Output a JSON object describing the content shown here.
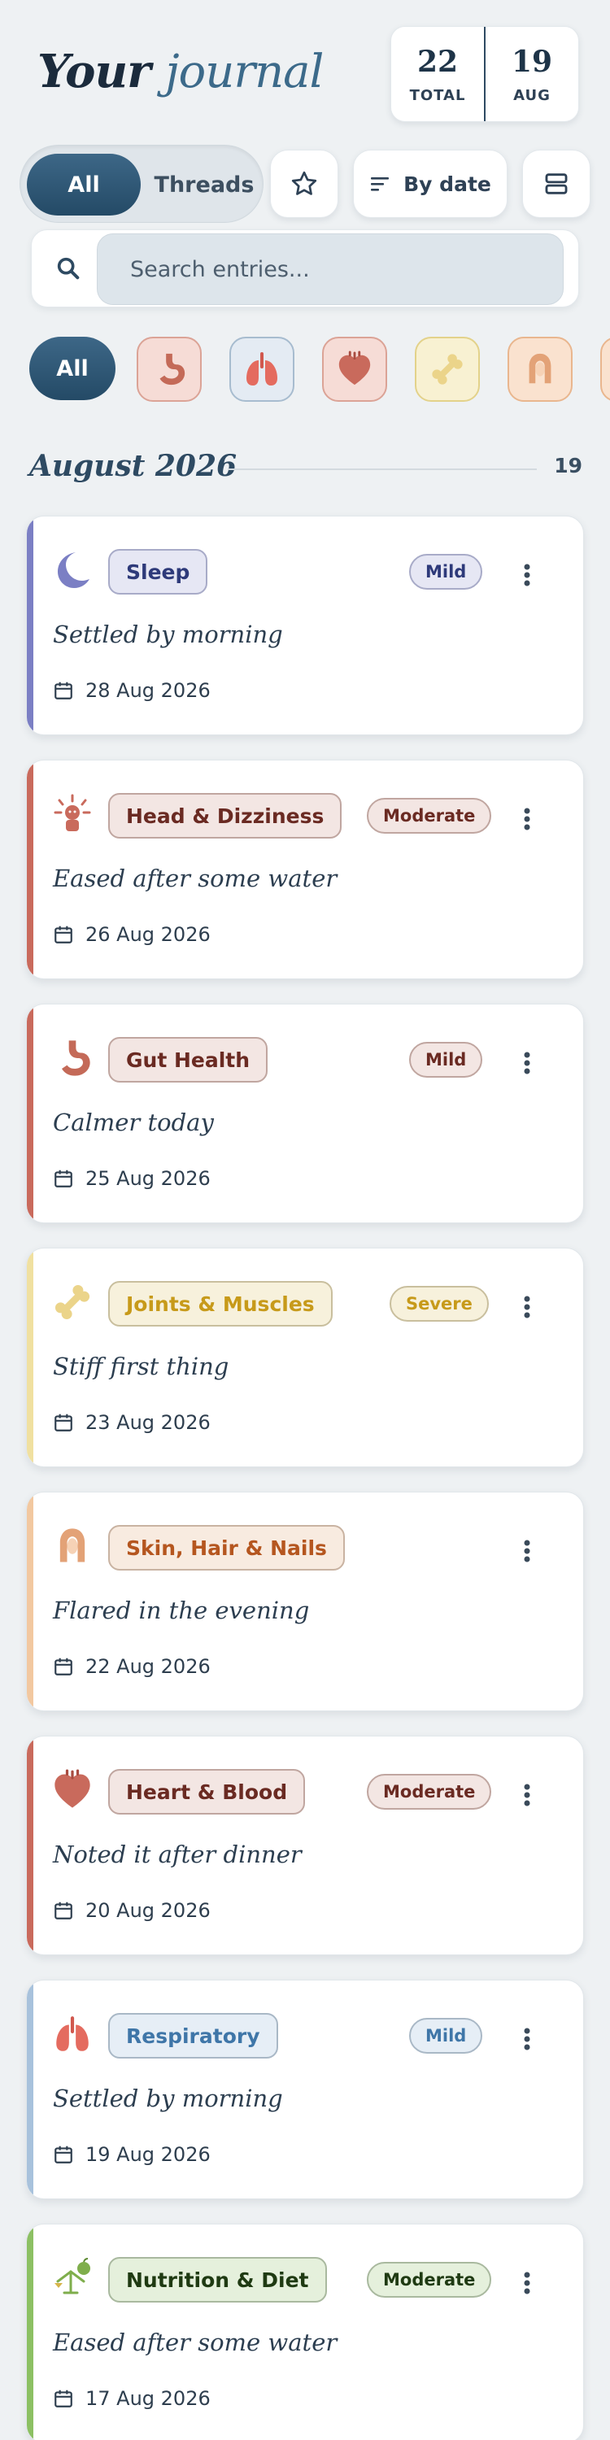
{
  "header": {
    "title_part1": "Your",
    "title_part2": "journal",
    "stats": [
      {
        "value": "22",
        "label": "TOTAL"
      },
      {
        "value": "19",
        "label": "AUG"
      }
    ]
  },
  "toolbar": {
    "segment_all": "All",
    "segment_threads": "Threads",
    "sort_label": "By date",
    "icons": {
      "favorites": "star-icon",
      "sort": "sort-lines-icon",
      "layout": "list-layout-icon"
    }
  },
  "search": {
    "placeholder": "Search entries..."
  },
  "filters": {
    "all_label": "All",
    "categories": [
      "stomach-icon",
      "lungs-icon",
      "heart-icon",
      "bone-icon",
      "hair-icon"
    ]
  },
  "month": {
    "title": "August 2026",
    "count": "19"
  },
  "entries": [
    {
      "category": "Sleep",
      "severity": "Mild",
      "note": "Settled by morning",
      "date": "28 Aug 2026",
      "icon": "moon-icon",
      "accent": "#7b7fc4"
    },
    {
      "category": "Head & Dizziness",
      "severity": "Moderate",
      "note": "Eased after some water",
      "date": "26 Aug 2026",
      "icon": "dizzy-head-icon",
      "accent": "#c96a5c"
    },
    {
      "category": "Gut Health",
      "severity": "Mild",
      "note": "Calmer today",
      "date": "25 Aug 2026",
      "icon": "stomach-icon",
      "accent": "#c96a5c"
    },
    {
      "category": "Joints & Muscles",
      "severity": "Severe",
      "note": "Stiff first thing",
      "date": "23 Aug 2026",
      "icon": "bone-icon",
      "accent": "#f0e0a0"
    },
    {
      "category": "Skin, Hair & Nails",
      "severity": "",
      "note": "Flared in the evening",
      "date": "22 Aug 2026",
      "icon": "hair-icon",
      "accent": "#f2c8a0"
    },
    {
      "category": "Heart & Blood",
      "severity": "Moderate",
      "note": "Noted it after dinner",
      "date": "20 Aug 2026",
      "icon": "heart-icon",
      "accent": "#c96a5c"
    },
    {
      "category": "Respiratory",
      "severity": "Mild",
      "note": "Settled by morning",
      "date": "19 Aug 2026",
      "icon": "lungs-icon",
      "accent": "#a8c2dc"
    },
    {
      "category": "Nutrition & Diet",
      "severity": "Moderate",
      "note": "Eased after some water",
      "date": "17 Aug 2026",
      "icon": "scale-apple-icon",
      "accent": "#8cc063"
    }
  ]
}
